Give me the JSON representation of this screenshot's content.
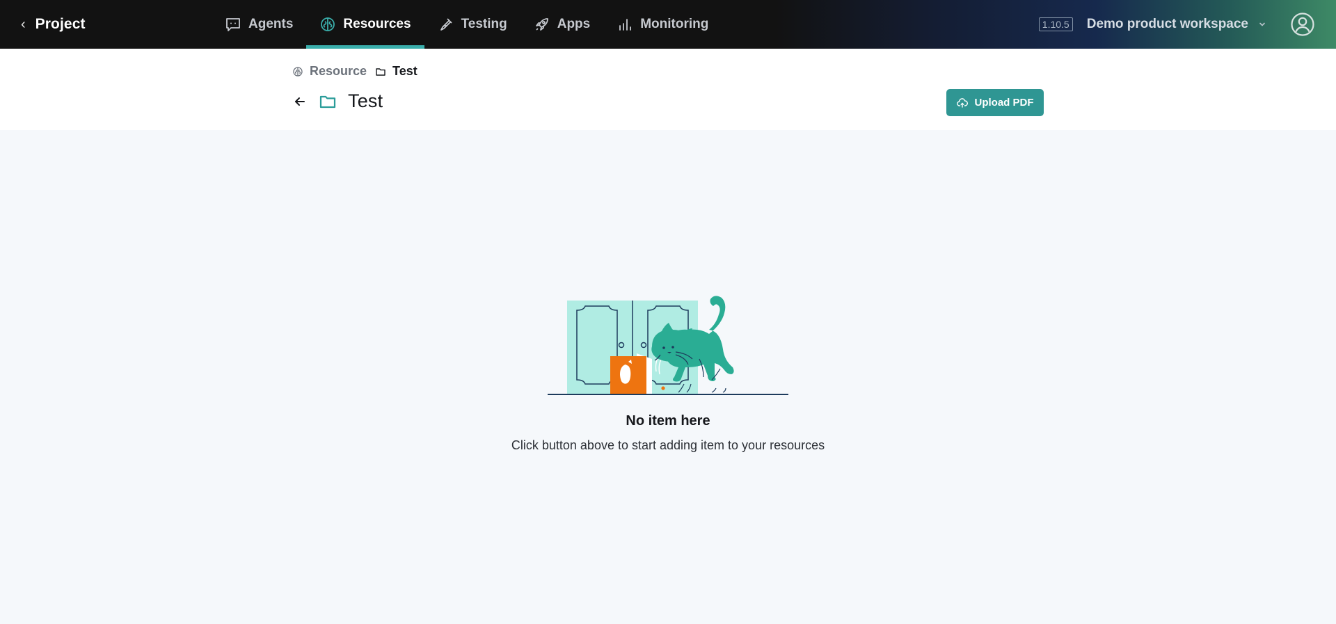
{
  "topbar": {
    "project_label": "Project",
    "tabs": [
      {
        "label": "Agents",
        "icon": "chat-bubble-icon"
      },
      {
        "label": "Resources",
        "icon": "brain-icon",
        "active": true
      },
      {
        "label": "Testing",
        "icon": "pipette-icon"
      },
      {
        "label": "Apps",
        "icon": "rocket-icon"
      },
      {
        "label": "Monitoring",
        "icon": "bar-chart-icon"
      }
    ],
    "version": "1.10.5",
    "workspace": "Demo product workspace"
  },
  "breadcrumb": {
    "root": "Resource",
    "current": "Test"
  },
  "page": {
    "title": "Test",
    "upload_label": "Upload PDF"
  },
  "empty_state": {
    "title": "No item here",
    "subtitle": "Click button above to start adding item to your resources"
  },
  "colors": {
    "accent": "#3aaeab",
    "button": "#2f9693",
    "cabinet": "#b0ece3",
    "cat": "#2aad94",
    "box": "#ee7410"
  }
}
